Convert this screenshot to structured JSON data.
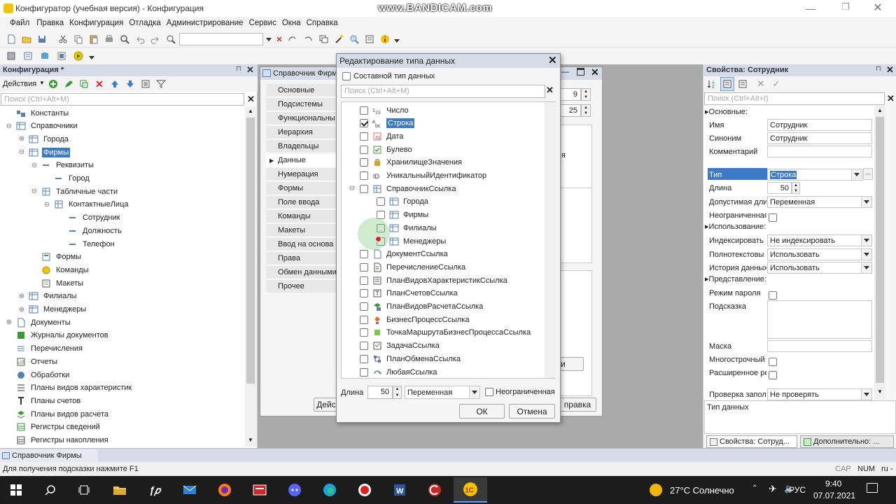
{
  "window": {
    "title": "Конфигуратор (учебная версия) - Конфигурация",
    "watermark": "www.BANDICAM.com"
  },
  "menu": [
    "Файл",
    "Правка",
    "Конфигурация",
    "Отладка",
    "Администрирование",
    "Сервис",
    "Окна",
    "Справка"
  ],
  "left_panel": {
    "title": "Конфигурация *",
    "actions_label": "Действия",
    "search_placeholder": "Поиск (Ctrl+Alt+M)",
    "tree": [
      {
        "label": "Константы",
        "level": 0,
        "exp": ""
      },
      {
        "label": "Справочники",
        "level": 0,
        "exp": "−"
      },
      {
        "label": "Города",
        "level": 1,
        "exp": "+"
      },
      {
        "label": "Фирмы",
        "level": 1,
        "exp": "−",
        "selected": true
      },
      {
        "label": "Реквизиты",
        "level": 2,
        "exp": "−"
      },
      {
        "label": "Город",
        "level": 3,
        "exp": ""
      },
      {
        "label": "Табличные части",
        "level": 2,
        "exp": "−"
      },
      {
        "label": "КонтактныеЛица",
        "level": 3,
        "exp": "−"
      },
      {
        "label": "Сотрудник",
        "level": 4,
        "exp": ""
      },
      {
        "label": "Должность",
        "level": 4,
        "exp": ""
      },
      {
        "label": "Телефон",
        "level": 4,
        "exp": ""
      },
      {
        "label": "Формы",
        "level": 2,
        "exp": ""
      },
      {
        "label": "Команды",
        "level": 2,
        "exp": ""
      },
      {
        "label": "Макеты",
        "level": 2,
        "exp": ""
      },
      {
        "label": "Филиалы",
        "level": 1,
        "exp": "+"
      },
      {
        "label": "Менеджеры",
        "level": 1,
        "exp": "+"
      },
      {
        "label": "Документы",
        "level": 0,
        "exp": "+"
      },
      {
        "label": "Журналы документов",
        "level": 0,
        "exp": ""
      },
      {
        "label": "Перечисления",
        "level": 0,
        "exp": ""
      },
      {
        "label": "Отчеты",
        "level": 0,
        "exp": ""
      },
      {
        "label": "Обработки",
        "level": 0,
        "exp": ""
      },
      {
        "label": "Планы видов характеристик",
        "level": 0,
        "exp": ""
      },
      {
        "label": "Планы счетов",
        "level": 0,
        "exp": ""
      },
      {
        "label": "Планы видов расчета",
        "level": 0,
        "exp": ""
      },
      {
        "label": "Регистры сведений",
        "level": 0,
        "exp": ""
      },
      {
        "label": "Регистры накопления",
        "level": 0,
        "exp": ""
      }
    ]
  },
  "catalog_window": {
    "title": "Справочник Фирм",
    "nav": [
      "Основные",
      "Подсистемы",
      "Функциональны",
      "Иерархия",
      "Владельцы",
      "Данные",
      "Нумерация",
      "Формы",
      "Поле ввода",
      "Команды",
      "Макеты",
      "Ввод на основа",
      "Права",
      "Обмен данными",
      "Прочее"
    ],
    "active_nav": 5,
    "num1": "9",
    "num2": "25",
    "partial_text": "я",
    "btn_left": "Дейс",
    "btn_right": "правка",
    "btn_mid": "и"
  },
  "dialog": {
    "title": "Редактирование типа данных",
    "composite_label": "Составной тип данных",
    "search_placeholder": "Поиск (Ctrl+Alt+M)",
    "types": [
      {
        "label": "Число",
        "level": 0,
        "checked": false,
        "exp": ""
      },
      {
        "label": "Строка",
        "level": 0,
        "checked": true,
        "exp": "",
        "selected": true
      },
      {
        "label": "Дата",
        "level": 0,
        "checked": false,
        "exp": ""
      },
      {
        "label": "Булево",
        "level": 0,
        "checked": false,
        "exp": ""
      },
      {
        "label": "ХранилищеЗначения",
        "level": 0,
        "checked": false,
        "exp": ""
      },
      {
        "label": "УникальныйИдентификатор",
        "level": 0,
        "checked": false,
        "exp": ""
      },
      {
        "label": "СправочникСсылка",
        "level": 0,
        "checked": false,
        "exp": "−"
      },
      {
        "label": "Города",
        "level": 1,
        "checked": false,
        "exp": ""
      },
      {
        "label": "Фирмы",
        "level": 1,
        "checked": false,
        "exp": ""
      },
      {
        "label": "Филиалы",
        "level": 1,
        "checked": false,
        "exp": ""
      },
      {
        "label": "Менеджеры",
        "level": 1,
        "checked": false,
        "exp": ""
      },
      {
        "label": "ДокументСсылка",
        "level": 0,
        "checked": false,
        "exp": ""
      },
      {
        "label": "ПеречислениеСсылка",
        "level": 0,
        "checked": false,
        "exp": ""
      },
      {
        "label": "ПланВидовХарактеристикСсылка",
        "level": 0,
        "checked": false,
        "exp": ""
      },
      {
        "label": "ПланСчетовСсылка",
        "level": 0,
        "checked": false,
        "exp": ""
      },
      {
        "label": "ПланВидовРасчетаСсылка",
        "level": 0,
        "checked": false,
        "exp": ""
      },
      {
        "label": "БизнесПроцессСсылка",
        "level": 0,
        "checked": false,
        "exp": ""
      },
      {
        "label": "ТочкаМаршрутаБизнесПроцессаСсылка",
        "level": 0,
        "checked": false,
        "exp": ""
      },
      {
        "label": "ЗадачаСсылка",
        "level": 0,
        "checked": false,
        "exp": ""
      },
      {
        "label": "ПланОбменаСсылка",
        "level": 0,
        "checked": false,
        "exp": ""
      },
      {
        "label": "ЛюбаяСсылка",
        "level": 0,
        "checked": false,
        "exp": ""
      }
    ],
    "length_label": "Длина",
    "length_value": "50",
    "length_mode": "Переменная",
    "unlimited_label": "Неограниченная",
    "ok_label": "ОК",
    "cancel_label": "Отмена"
  },
  "properties": {
    "title": "Свойства: Сотрудник",
    "search_placeholder": "Поиск (Ctrl+Alt+I)",
    "sec_main": "Основные:",
    "name_label": "Имя",
    "name_value": "Сотрудник",
    "synonym_label": "Синоним",
    "synonym_value": "Сотрудник",
    "comment_label": "Комментарий",
    "type_label": "Тип",
    "type_value": "Строка",
    "length_label": "Длина",
    "length_value": "50",
    "allowed_label": "Допустимая дли",
    "allowed_value": "Переменная",
    "unlimited_label": "Неограниченная",
    "sec_usage": "Использование:",
    "index_label": "Индексировать",
    "index_value": "Не индексировать",
    "fulltext_label": "Полнотекстовы",
    "fulltext_value": "Использовать",
    "history_label": "История данных",
    "history_value": "Использовать",
    "sec_view": "Представление:",
    "password_label": "Режим пароля",
    "hint_label": "Подсказка",
    "mask_label": "Маска",
    "multiline_label": "Многострочный",
    "extended_label": "Расширенное ре",
    "check_label": "Проверка запол",
    "check_value": "Не проверять",
    "desc": "Тип данных",
    "tab1": "Свойства: Сотруд...",
    "tab2": "Дополнительно: ..."
  },
  "taskbar_window": "Справочник Фирмы",
  "status": {
    "hint": "Для получения подсказки нажмите F1",
    "cap": "CAP",
    "num": "NUM",
    "lang": "ru -"
  },
  "taskbar": {
    "weather": "27°C Солнечно",
    "lang": "РУС",
    "time": "9:40",
    "date": "07.07.2021"
  }
}
